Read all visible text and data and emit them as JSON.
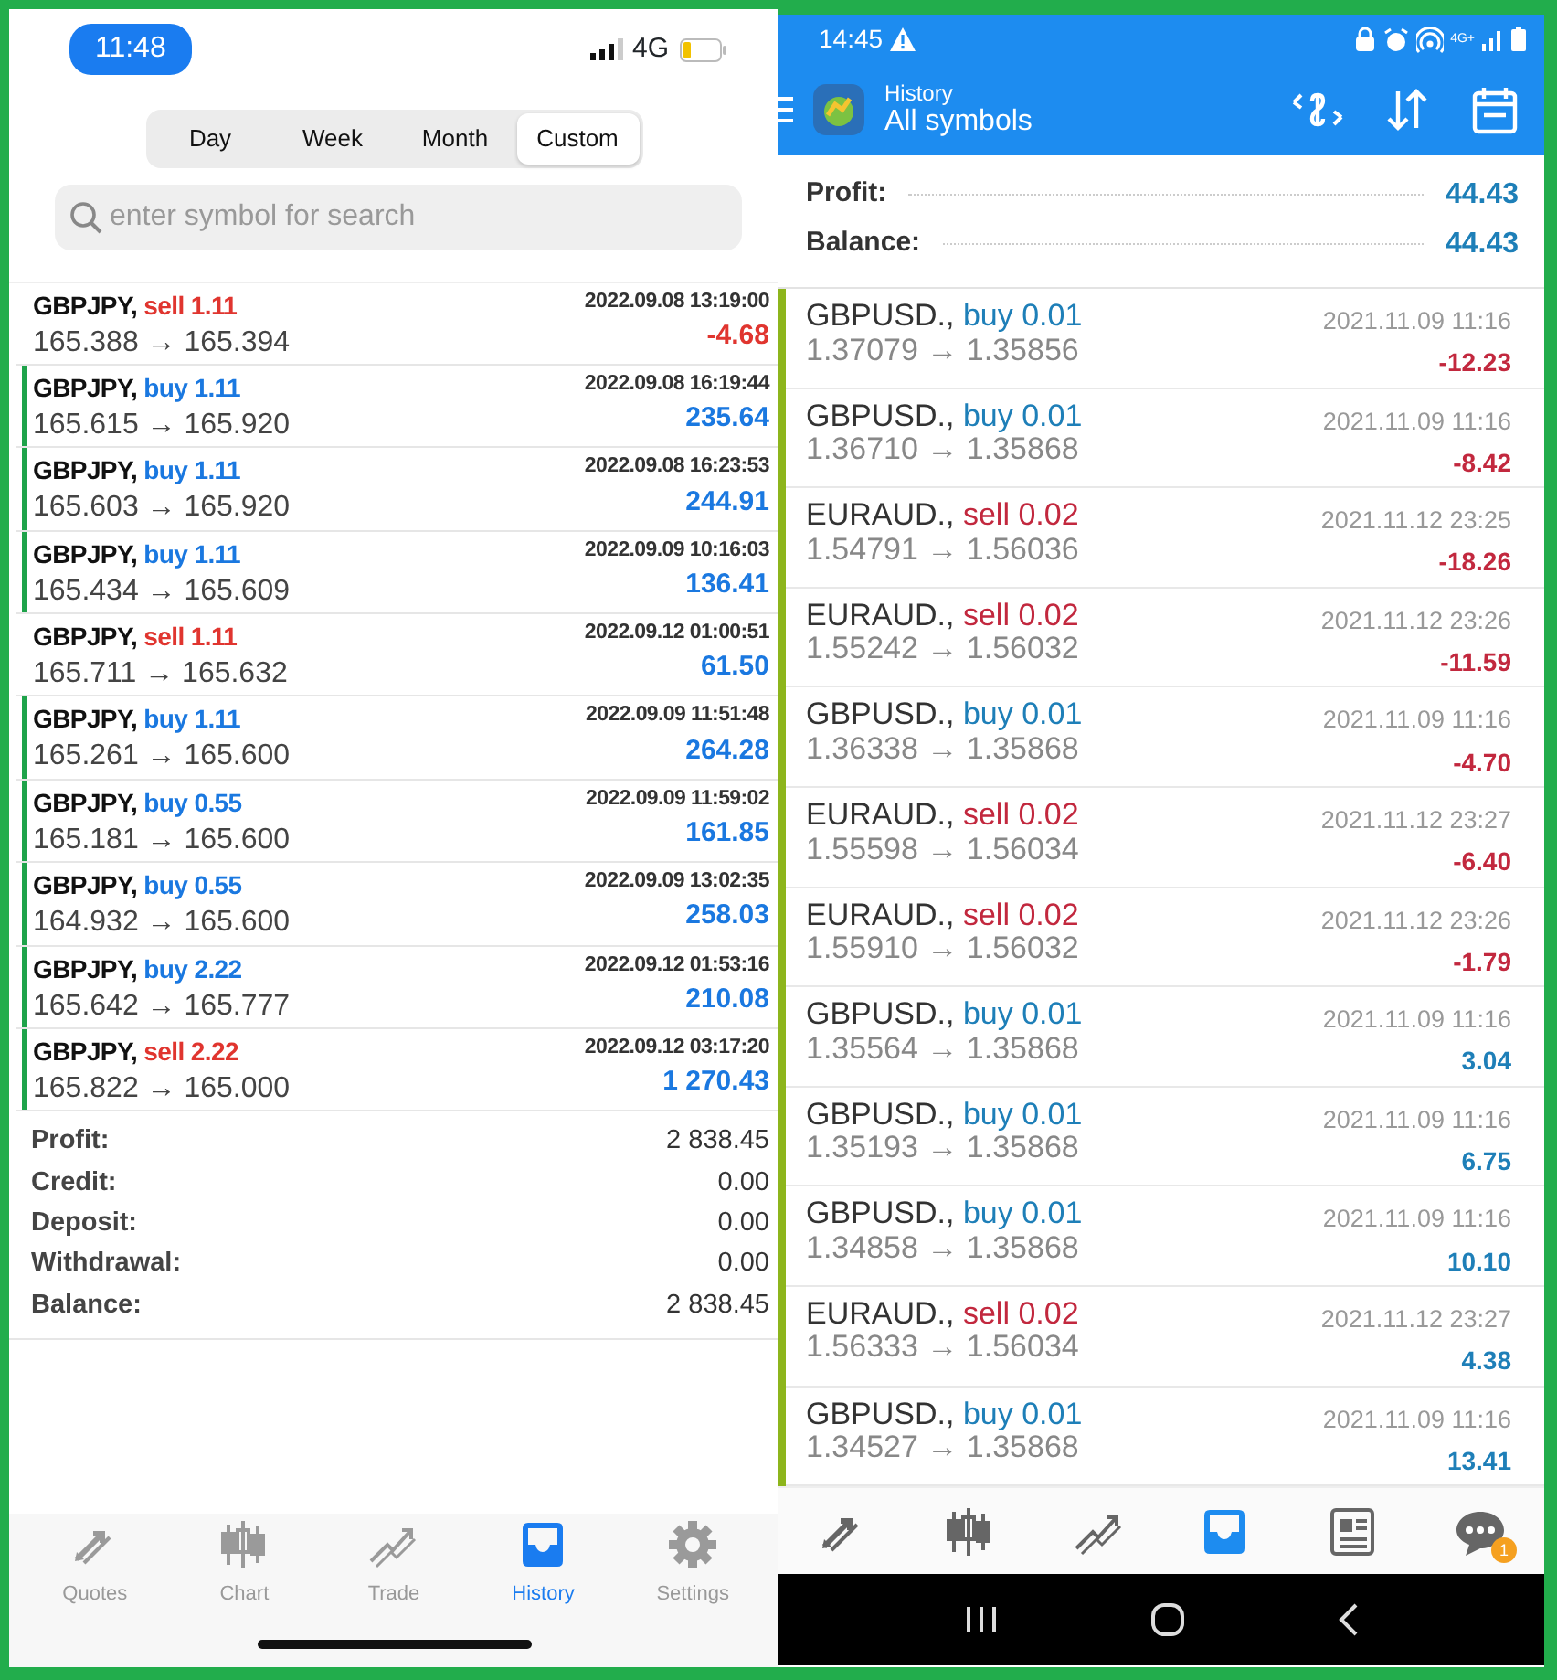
{
  "left_phone": {
    "status_bar": {
      "time": "11:48",
      "network": "4G"
    },
    "period_tabs": [
      {
        "label": "Day",
        "selected": false
      },
      {
        "label": "Week",
        "selected": false
      },
      {
        "label": "Month",
        "selected": false
      },
      {
        "label": "Custom",
        "selected": true
      }
    ],
    "search": {
      "placeholder": "enter symbol for search"
    },
    "deals": [
      {
        "symbol": "GBPJPY,",
        "side": "sell",
        "volume": "1.11",
        "color": "#e0352f",
        "prices": "165.388 → 165.394",
        "time": "2022.09.08 13:19:00",
        "profit": "-4.68",
        "loss": true,
        "marked": false
      },
      {
        "symbol": "GBPJPY,",
        "side": "buy",
        "volume": "1.11",
        "color": "#1a78e0",
        "prices": "165.615 → 165.920",
        "time": "2022.09.08 16:19:44",
        "profit": "235.64",
        "loss": false,
        "marked": true
      },
      {
        "symbol": "GBPJPY,",
        "side": "buy",
        "volume": "1.11",
        "color": "#1a78e0",
        "prices": "165.603 → 165.920",
        "time": "2022.09.08 16:23:53",
        "profit": "244.91",
        "loss": false,
        "marked": true
      },
      {
        "symbol": "GBPJPY,",
        "side": "buy",
        "volume": "1.11",
        "color": "#1a78e0",
        "prices": "165.434 → 165.609",
        "time": "2022.09.09 10:16:03",
        "profit": "136.41",
        "loss": false,
        "marked": true
      },
      {
        "symbol": "GBPJPY,",
        "side": "sell",
        "volume": "1.11",
        "color": "#e0352f",
        "prices": "165.711 → 165.632",
        "time": "2022.09.12 01:00:51",
        "profit": "61.50",
        "loss": false,
        "marked": false
      },
      {
        "symbol": "GBPJPY,",
        "side": "buy",
        "volume": "1.11",
        "color": "#1a78e0",
        "prices": "165.261 → 165.600",
        "time": "2022.09.09 11:51:48",
        "profit": "264.28",
        "loss": false,
        "marked": true
      },
      {
        "symbol": "GBPJPY,",
        "side": "buy",
        "volume": "0.55",
        "color": "#1a78e0",
        "prices": "165.181 → 165.600",
        "time": "2022.09.09 11:59:02",
        "profit": "161.85",
        "loss": false,
        "marked": true
      },
      {
        "symbol": "GBPJPY,",
        "side": "buy",
        "volume": "0.55",
        "color": "#1a78e0",
        "prices": "164.932 → 165.600",
        "time": "2022.09.09 13:02:35",
        "profit": "258.03",
        "loss": false,
        "marked": true
      },
      {
        "symbol": "GBPJPY,",
        "side": "buy",
        "volume": "2.22",
        "color": "#1a78e0",
        "prices": "165.642 → 165.777",
        "time": "2022.09.12 01:53:16",
        "profit": "210.08",
        "loss": false,
        "marked": true
      },
      {
        "symbol": "GBPJPY,",
        "side": "sell",
        "volume": "2.22",
        "color": "#e0352f",
        "prices": "165.822 → 165.000",
        "time": "2022.09.12 03:17:20",
        "profit": "1 270.43",
        "loss": false,
        "marked": true
      }
    ],
    "summary": [
      {
        "label": "Profit:",
        "value": "2 838.45"
      },
      {
        "label": "Credit:",
        "value": "0.00"
      },
      {
        "label": "Deposit:",
        "value": "0.00"
      },
      {
        "label": "Withdrawal:",
        "value": "0.00"
      },
      {
        "label": "Balance:",
        "value": "2 838.45"
      }
    ],
    "tab_bar": [
      {
        "label": "Quotes",
        "selected": false
      },
      {
        "label": "Chart",
        "selected": false
      },
      {
        "label": "Trade",
        "selected": false
      },
      {
        "label": "History",
        "selected": true
      },
      {
        "label": "Settings",
        "selected": false
      }
    ]
  },
  "right_phone": {
    "status_bar": {
      "time": "14:45",
      "network": "4G+"
    },
    "toolbar": {
      "title": "History",
      "subtitle": "All symbols"
    },
    "summary": [
      {
        "label": "Profit:",
        "value": "44.43"
      },
      {
        "label": "Balance:",
        "value": "44.43"
      }
    ],
    "deals": [
      {
        "symbol": "GBPUSD.,",
        "side": "buy",
        "volume": "0.01",
        "color": "#1e7fb8",
        "prices": "1.37079 → 1.35856",
        "time": "2021.11.09 11:16",
        "profit": "-12.23",
        "loss": true
      },
      {
        "symbol": "GBPUSD.,",
        "side": "buy",
        "volume": "0.01",
        "color": "#1e7fb8",
        "prices": "1.36710 → 1.35868",
        "time": "2021.11.09 11:16",
        "profit": "-8.42",
        "loss": true
      },
      {
        "symbol": "EURAUD.,",
        "side": "sell",
        "volume": "0.02",
        "color": "#c2283e",
        "prices": "1.54791 → 1.56036",
        "time": "2021.11.12 23:25",
        "profit": "-18.26",
        "loss": true
      },
      {
        "symbol": "EURAUD.,",
        "side": "sell",
        "volume": "0.02",
        "color": "#c2283e",
        "prices": "1.55242 → 1.56032",
        "time": "2021.11.12 23:26",
        "profit": "-11.59",
        "loss": true
      },
      {
        "symbol": "GBPUSD.,",
        "side": "buy",
        "volume": "0.01",
        "color": "#1e7fb8",
        "prices": "1.36338 → 1.35868",
        "time": "2021.11.09 11:16",
        "profit": "-4.70",
        "loss": true
      },
      {
        "symbol": "EURAUD.,",
        "side": "sell",
        "volume": "0.02",
        "color": "#c2283e",
        "prices": "1.55598 → 1.56034",
        "time": "2021.11.12 23:27",
        "profit": "-6.40",
        "loss": true
      },
      {
        "symbol": "EURAUD.,",
        "side": "sell",
        "volume": "0.02",
        "color": "#c2283e",
        "prices": "1.55910 → 1.56032",
        "time": "2021.11.12 23:26",
        "profit": "-1.79",
        "loss": true
      },
      {
        "symbol": "GBPUSD.,",
        "side": "buy",
        "volume": "0.01",
        "color": "#1e7fb8",
        "prices": "1.35564 → 1.35868",
        "time": "2021.11.09 11:16",
        "profit": "3.04",
        "loss": false
      },
      {
        "symbol": "GBPUSD.,",
        "side": "buy",
        "volume": "0.01",
        "color": "#1e7fb8",
        "prices": "1.35193 → 1.35868",
        "time": "2021.11.09 11:16",
        "profit": "6.75",
        "loss": false
      },
      {
        "symbol": "GBPUSD.,",
        "side": "buy",
        "volume": "0.01",
        "color": "#1e7fb8",
        "prices": "1.34858 → 1.35868",
        "time": "2021.11.09 11:16",
        "profit": "10.10",
        "loss": false
      },
      {
        "symbol": "EURAUD.,",
        "side": "sell",
        "volume": "0.02",
        "color": "#c2283e",
        "prices": "1.56333 → 1.56034",
        "time": "2021.11.12 23:27",
        "profit": "4.38",
        "loss": false
      },
      {
        "symbol": "GBPUSD.,",
        "side": "buy",
        "volume": "0.01",
        "color": "#1e7fb8",
        "prices": "1.34527 → 1.35868",
        "time": "2021.11.09 11:16",
        "profit": "13.41",
        "loss": false
      }
    ],
    "tab_bar": [
      {
        "selected": false
      },
      {
        "selected": false
      },
      {
        "selected": false
      },
      {
        "selected": true
      },
      {
        "selected": false
      },
      {
        "selected": false,
        "badge": "1"
      }
    ]
  }
}
